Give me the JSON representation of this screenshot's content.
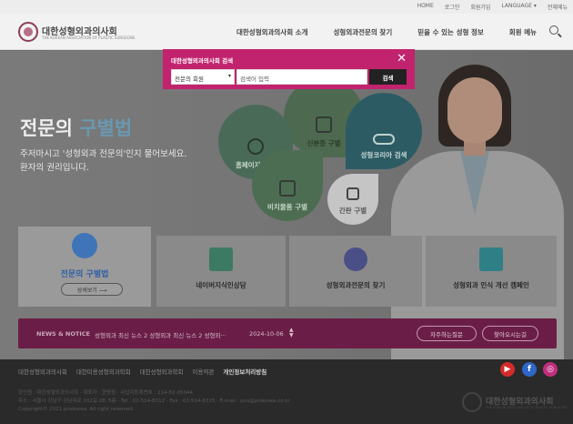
{
  "util": {
    "links": [
      "HOME",
      "로그인",
      "회원가입",
      "LANGUAGE ▾",
      "전체메뉴"
    ]
  },
  "header": {
    "logo_title": "대한성형외과의사회",
    "logo_subtitle": "THE KOREAN ASSOCIATION OF PLASTIC SURGEONS",
    "nav": [
      "대한성형외과의사회 소개",
      "성형외과전문의 찾기",
      "믿을 수 있는 성형 정보",
      "회원 메뉴"
    ]
  },
  "hero": {
    "title_plain": "전문의 ",
    "title_highlight": "구별법",
    "desc_line1": "주저마시고 '성형외과 전문의'인지 물어보세요.",
    "desc_line2": "환자의 권리입니다.",
    "bubbles": [
      "신분증 구별",
      "성형코리아 검색",
      "홈페이지 검색",
      "비치물품 구별",
      "간판 구별"
    ]
  },
  "cards": {
    "main_label": "전문의 구별법",
    "main_more": "상세보기 ⟶",
    "items": [
      "네이버지식인상담",
      "성형외과전문의 찾기",
      "성형외과 인식 개선 캠페인"
    ]
  },
  "news": {
    "label": "NEWS & NOTICE",
    "text": "성형외과 최신 뉴스 2 성형외과 최신 뉴스 2 성형외···",
    "date": "2024-10-06",
    "faq": "자주하는질문",
    "directions": "찾아오시는길"
  },
  "footer": {
    "links": [
      "대한성형외과의사회",
      "대한미용성형외과학회",
      "대한성형외과학회",
      "이용약관",
      "개인정보처리방침"
    ],
    "info_line1": "한인원 : 대한성형외과의사회 · 대표자 : 한방원 · 사업자등록번호 : 214-82-05044",
    "info_line2": "주소 : 서울시 강남구 강남대로 102길 28, 5층 · Tel : 02-514-8312 · Fax : 02-514-8315 · E-mail : pns@prskorea.co.kr",
    "copyright": "Copyright© 2021 pnskorea. All right reserved.",
    "logo_title": "대한성형외과의사회",
    "logo_subtitle": "THE KOREAN ASSOCIATION OF PLASTIC SURGEONS",
    "sns": [
      "youtube-icon",
      "facebook-icon",
      "instagram-icon"
    ]
  },
  "modal": {
    "title": "대한성형외과의사회 검색",
    "select_value": "전문의 회원",
    "input_placeholder": "검색어 입력",
    "search_button": "검색",
    "accent_color": "#c2236e"
  }
}
